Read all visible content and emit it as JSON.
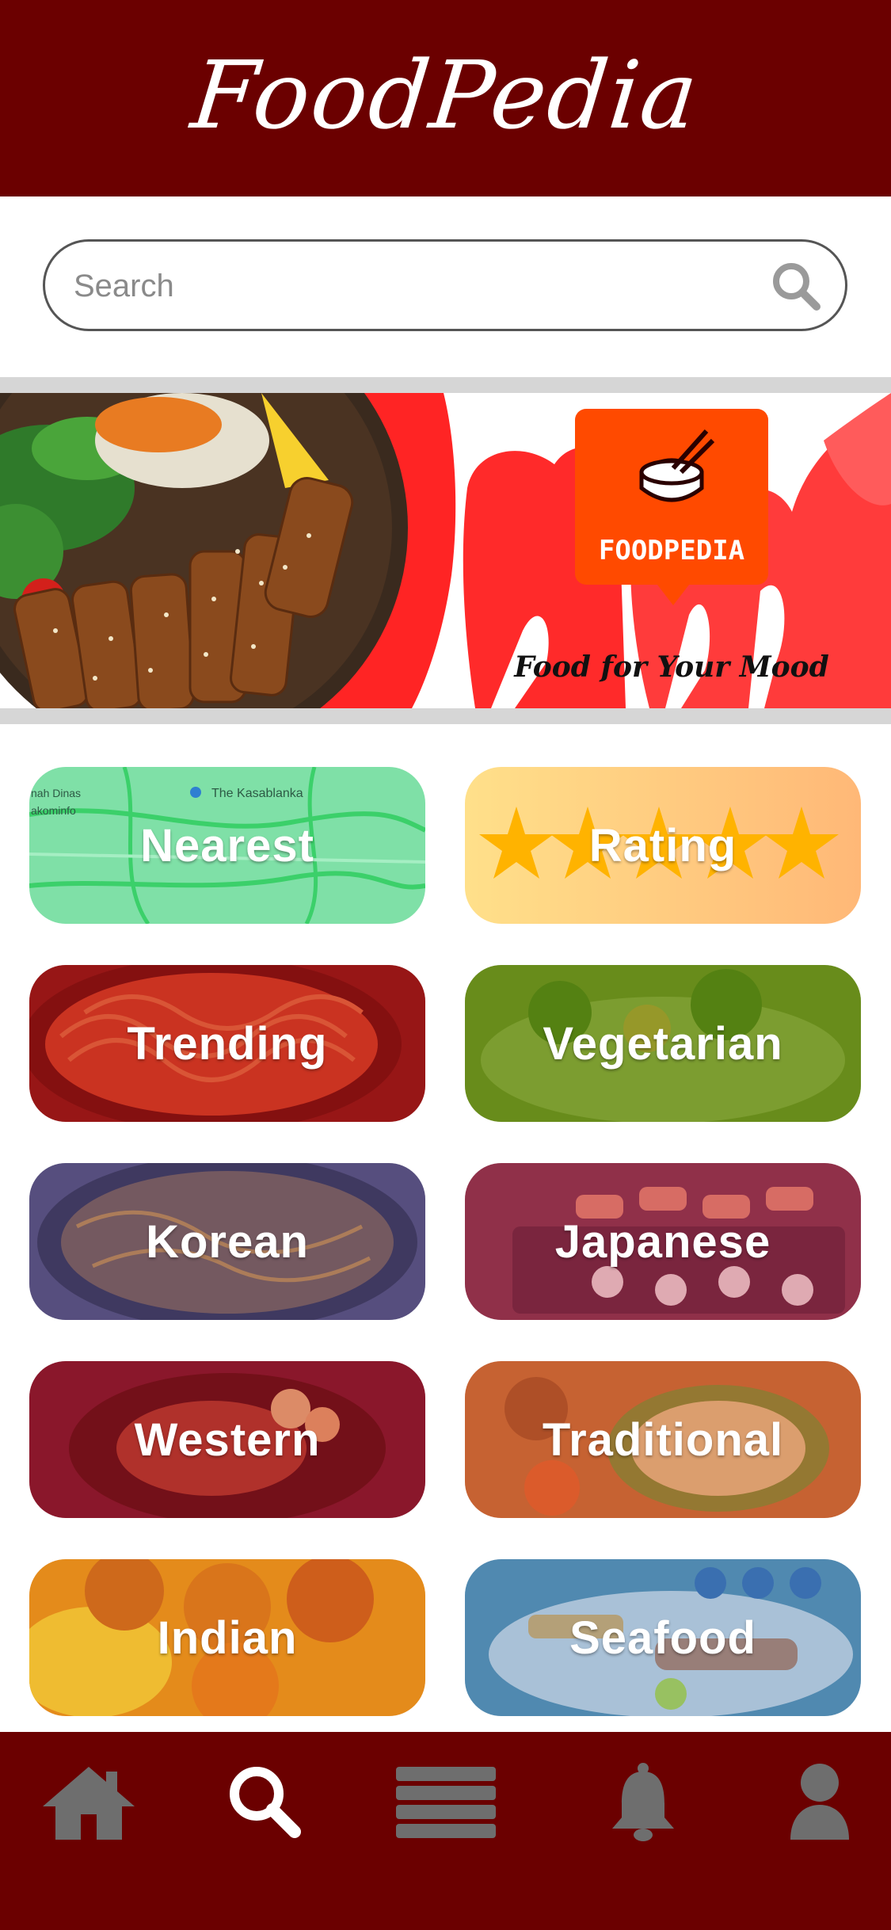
{
  "app": {
    "title": "FoodPedia"
  },
  "search": {
    "placeholder": "Search",
    "value": ""
  },
  "banner": {
    "brand": "FOODPEDIA",
    "tagline": "Food for Your Mood"
  },
  "categories": [
    {
      "label": "Nearest"
    },
    {
      "label": "Rating"
    },
    {
      "label": "Trending"
    },
    {
      "label": "Vegetarian"
    },
    {
      "label": "Korean"
    },
    {
      "label": "Japanese"
    },
    {
      "label": "Western"
    },
    {
      "label": "Traditional"
    },
    {
      "label": "Indian"
    },
    {
      "label": "Seafood"
    }
  ],
  "map_labels": {
    "place": "The Kasablanka",
    "left_top": "nah Dinas",
    "left_bottom": "akominfo"
  },
  "bottom_nav": [
    {
      "icon": "home-icon",
      "active": false
    },
    {
      "icon": "search-icon",
      "active": true
    },
    {
      "icon": "menu-icon",
      "active": false
    },
    {
      "icon": "bell-icon",
      "active": false
    },
    {
      "icon": "user-icon",
      "active": false
    }
  ],
  "colors": {
    "brand": "#6b0000",
    "banner_red": "#ff2020",
    "logo_orange": "#ff4a00",
    "nav_inactive": "#6e6e6e",
    "nav_active": "#ffffff"
  }
}
